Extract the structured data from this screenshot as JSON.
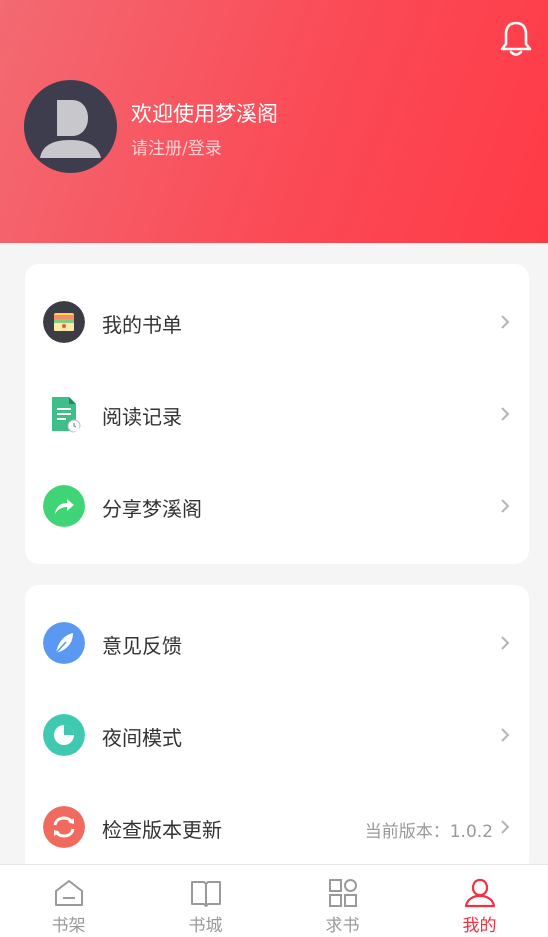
{
  "profile": {
    "welcome": "欢迎使用梦溪阁",
    "login": "请注册/登录"
  },
  "menu1": [
    {
      "label": "我的书单",
      "icon": "booklist-icon"
    },
    {
      "label": "阅读记录",
      "icon": "reading-history-icon"
    },
    {
      "label": "分享梦溪阁",
      "icon": "share-icon"
    }
  ],
  "menu2": [
    {
      "label": "意见反馈",
      "icon": "feather-icon"
    },
    {
      "label": "夜间模式",
      "icon": "night-mode-icon"
    },
    {
      "label": "检查版本更新",
      "icon": "refresh-icon",
      "detail": "当前版本：1.0.2"
    }
  ],
  "tabs": [
    {
      "label": "书架",
      "icon": "home-icon"
    },
    {
      "label": "书城",
      "icon": "book-icon"
    },
    {
      "label": "求书",
      "icon": "grid-icon"
    },
    {
      "label": "我的",
      "icon": "user-icon",
      "active": true
    }
  ],
  "colors": {
    "accent": "#f23040",
    "header_start": "#f36a72",
    "header_end": "#ff3a46"
  }
}
